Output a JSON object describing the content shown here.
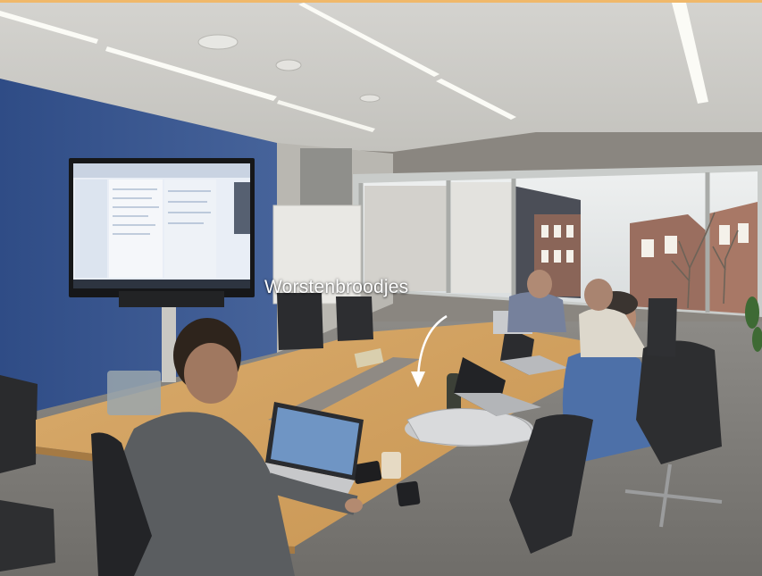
{
  "annotation": {
    "text": "Worstenbroodjes"
  },
  "colors": {
    "ceiling": "#d8d8d4",
    "accent_wall": "#3d5a94",
    "table": "#d6a564",
    "carpet": "#7c7a76",
    "window_sky": "#e6e9ea",
    "frame_accent": "#f0b86a"
  },
  "icons": [
    "down-arrow-icon"
  ]
}
